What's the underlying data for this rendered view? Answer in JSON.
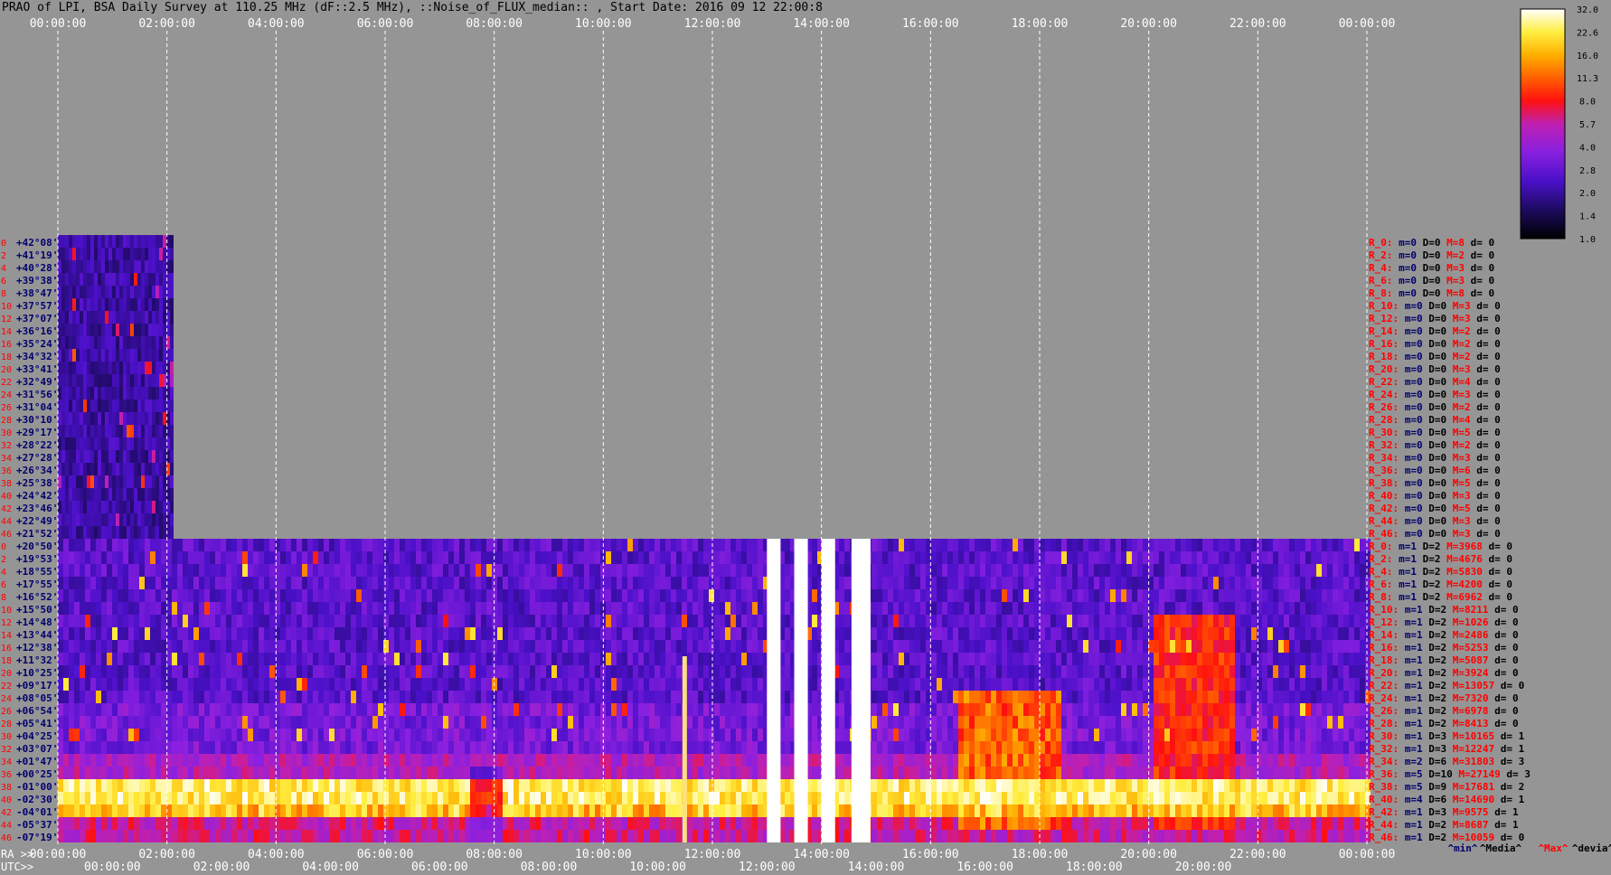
{
  "title": "PRAO of LPI, BSA Daily Survey at 110.25 MHz (dF::2.5 MHz), ::Noise_of_FLUX_median:: , Start Date: 2016 09 12 22:00:8",
  "chart_data": {
    "type": "heatmap",
    "top_time_ticks": [
      "00:00:00",
      "02:00:00",
      "04:00:00",
      "06:00:00",
      "08:00:00",
      "10:00:00",
      "12:00:00",
      "14:00:00",
      "16:00:00",
      "18:00:00",
      "20:00:00",
      "22:00:00",
      "00:00:00"
    ],
    "ra_label": "RA >>",
    "utc_label": "UTC>>",
    "ra_ticks": [
      "00:00:00",
      "02:00:00",
      "04:00:00",
      "06:00:00",
      "08:00:00",
      "10:00:00",
      "12:00:00",
      "14:00:00",
      "16:00:00",
      "18:00:00",
      "20:00:00",
      "22:00:00",
      "00:00:00"
    ],
    "utc_ticks": [
      "00:00:00",
      "02:00:00",
      "04:00:00",
      "06:00:00",
      "08:00:00",
      "10:00:00",
      "12:00:00",
      "14:00:00",
      "16:00:00",
      "18:00:00",
      "20:00:00"
    ],
    "colorbar": {
      "ticks": [
        "32.0",
        "22.6",
        "16.0",
        "11.3",
        "8.0",
        "5.7",
        "4.0",
        "2.8",
        "2.0",
        "1.4",
        "1.0"
      ]
    },
    "upper_block": {
      "row_numbers": [
        "0",
        "2",
        "4",
        "6",
        "8",
        "10",
        "12",
        "14",
        "16",
        "18",
        "20",
        "22",
        "24",
        "26",
        "28",
        "30",
        "32",
        "34",
        "36",
        "38",
        "40",
        "42",
        "44",
        "46"
      ],
      "declinations": [
        "+42°08'",
        "+41°19'",
        "+40°28'",
        "+39°38'",
        "+38°47'",
        "+37°57'",
        "+37°07'",
        "+36°16'",
        "+35°24'",
        "+34°32'",
        "+33°41'",
        "+32°49'",
        "+31°56'",
        "+31°04'",
        "+30°10'",
        "+29°17'",
        "+28°22'",
        "+27°28'",
        "+26°34'",
        "+25°38'",
        "+24°42'",
        "+23°46'",
        "+22°49'",
        "+21°52'"
      ],
      "stats": [
        {
          "r": "R_0:",
          "m": "m=0",
          "D": "D=0",
          "M": "M=8",
          "d": "d= 0"
        },
        {
          "r": "R_2:",
          "m": "m=0",
          "D": "D=0",
          "M": "M=2",
          "d": "d= 0"
        },
        {
          "r": "R_4:",
          "m": "m=0",
          "D": "D=0",
          "M": "M=3",
          "d": "d= 0"
        },
        {
          "r": "R_6:",
          "m": "m=0",
          "D": "D=0",
          "M": "M=3",
          "d": "d= 0"
        },
        {
          "r": "R_8:",
          "m": "m=0",
          "D": "D=0",
          "M": "M=8",
          "d": "d= 0"
        },
        {
          "r": "R_10:",
          "m": "m=0",
          "D": "D=0",
          "M": "M=3",
          "d": "d= 0"
        },
        {
          "r": "R_12:",
          "m": "m=0",
          "D": "D=0",
          "M": "M=3",
          "d": "d= 0"
        },
        {
          "r": "R_14:",
          "m": "m=0",
          "D": "D=0",
          "M": "M=2",
          "d": "d= 0"
        },
        {
          "r": "R_16:",
          "m": "m=0",
          "D": "D=0",
          "M": "M=2",
          "d": "d= 0"
        },
        {
          "r": "R_18:",
          "m": "m=0",
          "D": "D=0",
          "M": "M=2",
          "d": "d= 0"
        },
        {
          "r": "R_20:",
          "m": "m=0",
          "D": "D=0",
          "M": "M=3",
          "d": "d= 0"
        },
        {
          "r": "R_22:",
          "m": "m=0",
          "D": "D=0",
          "M": "M=4",
          "d": "d= 0"
        },
        {
          "r": "R_24:",
          "m": "m=0",
          "D": "D=0",
          "M": "M=3",
          "d": "d= 0"
        },
        {
          "r": "R_26:",
          "m": "m=0",
          "D": "D=0",
          "M": "M=2",
          "d": "d= 0"
        },
        {
          "r": "R_28:",
          "m": "m=0",
          "D": "D=0",
          "M": "M=4",
          "d": "d= 0"
        },
        {
          "r": "R_30:",
          "m": "m=0",
          "D": "D=0",
          "M": "M=5",
          "d": "d= 0"
        },
        {
          "r": "R_32:",
          "m": "m=0",
          "D": "D=0",
          "M": "M=2",
          "d": "d= 0"
        },
        {
          "r": "R_34:",
          "m": "m=0",
          "D": "D=0",
          "M": "M=3",
          "d": "d= 0"
        },
        {
          "r": "R_36:",
          "m": "m=0",
          "D": "D=0",
          "M": "M=6",
          "d": "d= 0"
        },
        {
          "r": "R_38:",
          "m": "m=0",
          "D": "D=0",
          "M": "M=5",
          "d": "d= 0"
        },
        {
          "r": "R_40:",
          "m": "m=0",
          "D": "D=0",
          "M": "M=3",
          "d": "d= 0"
        },
        {
          "r": "R_42:",
          "m": "m=0",
          "D": "D=0",
          "M": "M=5",
          "d": "d= 0"
        },
        {
          "r": "R_44:",
          "m": "m=0",
          "D": "D=0",
          "M": "M=3",
          "d": "d= 0"
        },
        {
          "r": "R_46:",
          "m": "m=0",
          "D": "D=0",
          "M": "M=3",
          "d": "d= 0"
        }
      ]
    },
    "lower_block": {
      "row_numbers": [
        "0",
        "2",
        "4",
        "6",
        "8",
        "10",
        "12",
        "14",
        "16",
        "18",
        "20",
        "22",
        "24",
        "26",
        "28",
        "30",
        "32",
        "34",
        "36",
        "38",
        "40",
        "42",
        "44",
        "46"
      ],
      "declinations": [
        "+20°50'",
        "+19°53'",
        "+18°55'",
        "+17°55'",
        "+16°52'",
        "+15°50'",
        "+14°48'",
        "+13°44'",
        "+12°38'",
        "+11°32'",
        "+10°25'",
        "+09°17'",
        "+08°05'",
        "+06°54'",
        "+05°41'",
        "+04°25'",
        "+03°07'",
        "+01°47'",
        "+00°25'",
        "-01°00'",
        "-02°30'",
        "-04°01'",
        "-05°37'",
        "-07°19'"
      ],
      "stats": [
        {
          "r": "R_0:",
          "m": "m=1",
          "D": "D=2",
          "M": "M=3968",
          "d": "d= 0"
        },
        {
          "r": "R_2:",
          "m": "m=1",
          "D": "D=2",
          "M": "M=4676",
          "d": "d= 0"
        },
        {
          "r": "R_4:",
          "m": "m=1",
          "D": "D=2",
          "M": "M=5830",
          "d": "d= 0"
        },
        {
          "r": "R_6:",
          "m": "m=1",
          "D": "D=2",
          "M": "M=4200",
          "d": "d= 0"
        },
        {
          "r": "R_8:",
          "m": "m=1",
          "D": "D=2",
          "M": "M=6962",
          "d": "d= 0"
        },
        {
          "r": "R_10:",
          "m": "m=1",
          "D": "D=2",
          "M": "M=8211",
          "d": "d= 0"
        },
        {
          "r": "R_12:",
          "m": "m=1",
          "D": "D=2",
          "M": "M=1026",
          "d": "d= 0"
        },
        {
          "r": "R_14:",
          "m": "m=1",
          "D": "D=2",
          "M": "M=2486",
          "d": "d= 0"
        },
        {
          "r": "R_16:",
          "m": "m=1",
          "D": "D=2",
          "M": "M=5253",
          "d": "d= 0"
        },
        {
          "r": "R_18:",
          "m": "m=1",
          "D": "D=2",
          "M": "M=5087",
          "d": "d= 0"
        },
        {
          "r": "R_20:",
          "m": "m=1",
          "D": "D=2",
          "M": "M=3924",
          "d": "d= 0"
        },
        {
          "r": "R_22:",
          "m": "m=1",
          "D": "D=2",
          "M": "M=13057",
          "d": "d= 0"
        },
        {
          "r": "R_24:",
          "m": "m=1",
          "D": "D=2",
          "M": "M=7320",
          "d": "d= 0"
        },
        {
          "r": "R_26:",
          "m": "m=1",
          "D": "D=2",
          "M": "M=6978",
          "d": "d= 0"
        },
        {
          "r": "R_28:",
          "m": "m=1",
          "D": "D=2",
          "M": "M=8413",
          "d": "d= 0"
        },
        {
          "r": "R_30:",
          "m": "m=1",
          "D": "D=3",
          "M": "M=10165",
          "d": "d= 1"
        },
        {
          "r": "R_32:",
          "m": "m=1",
          "D": "D=3",
          "M": "M=12247",
          "d": "d= 1"
        },
        {
          "r": "R_34:",
          "m": "m=2",
          "D": "D=6",
          "M": "M=31803",
          "d": "d= 3"
        },
        {
          "r": "R_36:",
          "m": "m=5",
          "D": "D=10",
          "M": "M=27149",
          "d": "d= 3"
        },
        {
          "r": "R_38:",
          "m": "m=5",
          "D": "D=9",
          "M": "M=17681",
          "d": "d= 2"
        },
        {
          "r": "R_40:",
          "m": "m=4",
          "D": "D=6",
          "M": "M=14690",
          "d": "d= 1"
        },
        {
          "r": "R_42:",
          "m": "m=1",
          "D": "D=3",
          "M": "M=9575",
          "d": "d= 1"
        },
        {
          "r": "R_44:",
          "m": "m=1",
          "D": "D=2",
          "M": "M=8687",
          "d": "d= 1"
        },
        {
          "r": "R_46:",
          "m": "m=1",
          "D": "D=2",
          "M": "M=10059",
          "d": "d= 0"
        }
      ]
    },
    "stats_legend": [
      "^min^",
      "^Media^",
      "^Max^",
      "^devia^"
    ],
    "colors": {
      "label_red": "#ff0000",
      "label_navy": "#00006e",
      "bg": "#959595",
      "white": "#ffffff"
    }
  }
}
